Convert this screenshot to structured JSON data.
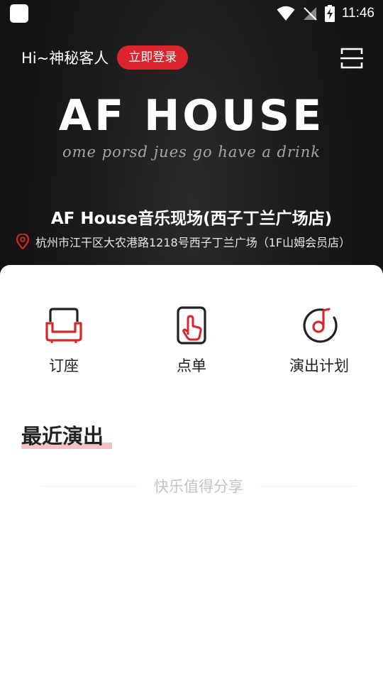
{
  "status_bar": {
    "time": "11:46"
  },
  "header": {
    "greeting": "Hi~神秘客人",
    "login_label": "立即登录",
    "logo_title": "AF HOUSE",
    "logo_tagline": "ome porsd jues go have a drink",
    "store_name": "AF House音乐现场(西子丁兰广场店)",
    "store_address": "杭州市江干区大农港路1218号西子丁兰广场（1F山姆会员店）"
  },
  "features": [
    {
      "label": "订座",
      "icon": "sofa-icon"
    },
    {
      "label": "点单",
      "icon": "tap-hand-icon"
    },
    {
      "label": "演出计划",
      "icon": "music-disc-icon"
    }
  ],
  "recent_shows": {
    "title": "最近演出",
    "empty_text": "快乐值得分享"
  },
  "colors": {
    "accent": "#d8262c",
    "highlight": "#f4c2c4"
  }
}
